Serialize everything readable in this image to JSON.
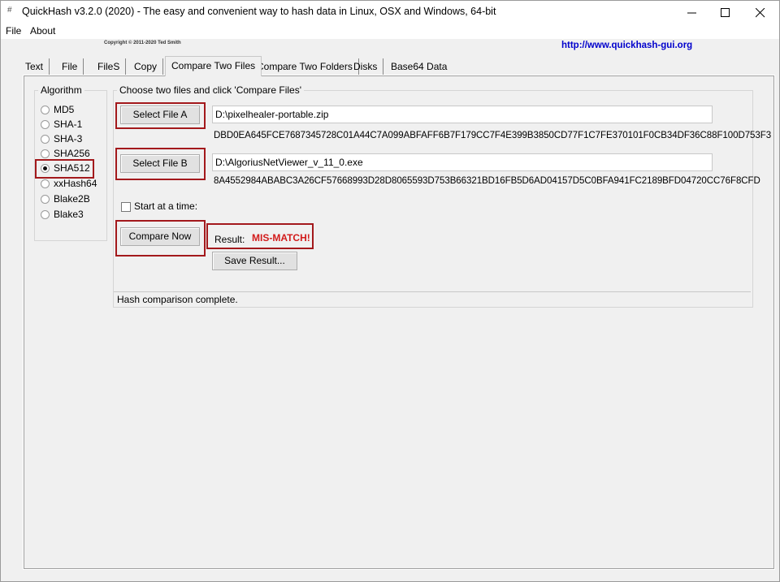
{
  "window": {
    "title": "QuickHash v3.2.0 (2020) - The easy and convenient way to hash data in Linux, OSX and Windows, 64-bit",
    "app_icon": "#"
  },
  "menu": {
    "file": "File",
    "about": "About"
  },
  "copyright": "Copyright © 2011-2020  Ted Smith",
  "website": "http://www.quickhash-gui.org",
  "tabs": [
    {
      "label": "Text",
      "active": false
    },
    {
      "label": "File",
      "active": false
    },
    {
      "label": "FileS",
      "active": false
    },
    {
      "label": "Copy",
      "active": false
    },
    {
      "label": "Compare Two Files",
      "active": true
    },
    {
      "label": "Compare Two Folders",
      "active": false
    },
    {
      "label": "Disks",
      "active": false
    },
    {
      "label": "Base64 Data",
      "active": false
    }
  ],
  "algorithm": {
    "title": "Algorithm",
    "options": [
      {
        "label": "MD5",
        "selected": false
      },
      {
        "label": "SHA-1",
        "selected": false
      },
      {
        "label": "SHA-3",
        "selected": false
      },
      {
        "label": "SHA256",
        "selected": false
      },
      {
        "label": "SHA512",
        "selected": true
      },
      {
        "label": "xxHash64",
        "selected": false
      },
      {
        "label": "Blake2B",
        "selected": false
      },
      {
        "label": "Blake3",
        "selected": false
      }
    ]
  },
  "compare": {
    "title": "Choose two files and click 'Compare Files'",
    "select_a_label": "Select File A",
    "file_a_path": "D:\\pixelhealer-portable.zip",
    "hash_a": "DBD0EA645FCE7687345728C01A44C7A099ABFAFF6B7F179CC7F4E399B3850CD77F1C7FE370101F0CB34DF36C88F100D753F3",
    "select_b_label": "Select File B",
    "file_b_path": "D:\\AlgoriusNetViewer_v_11_0.exe",
    "hash_b": "8A4552984ABABC3A26CF57668993D28D8065593D753B66321BD16FB5D6AD04157D5C0BFA941FC2189BFD04720CC76F8CFD",
    "start_at_time_label": "Start at a time:",
    "start_at_time_checked": false,
    "compare_now_label": "Compare Now",
    "result_label": "Result:",
    "result_value": "MIS-MATCH!",
    "save_result_label": "Save Result..."
  },
  "status": "Hash comparison complete.",
  "colors": {
    "highlight": "#a3191c",
    "mismatch": "#d21b1b",
    "link": "#0000cc"
  }
}
